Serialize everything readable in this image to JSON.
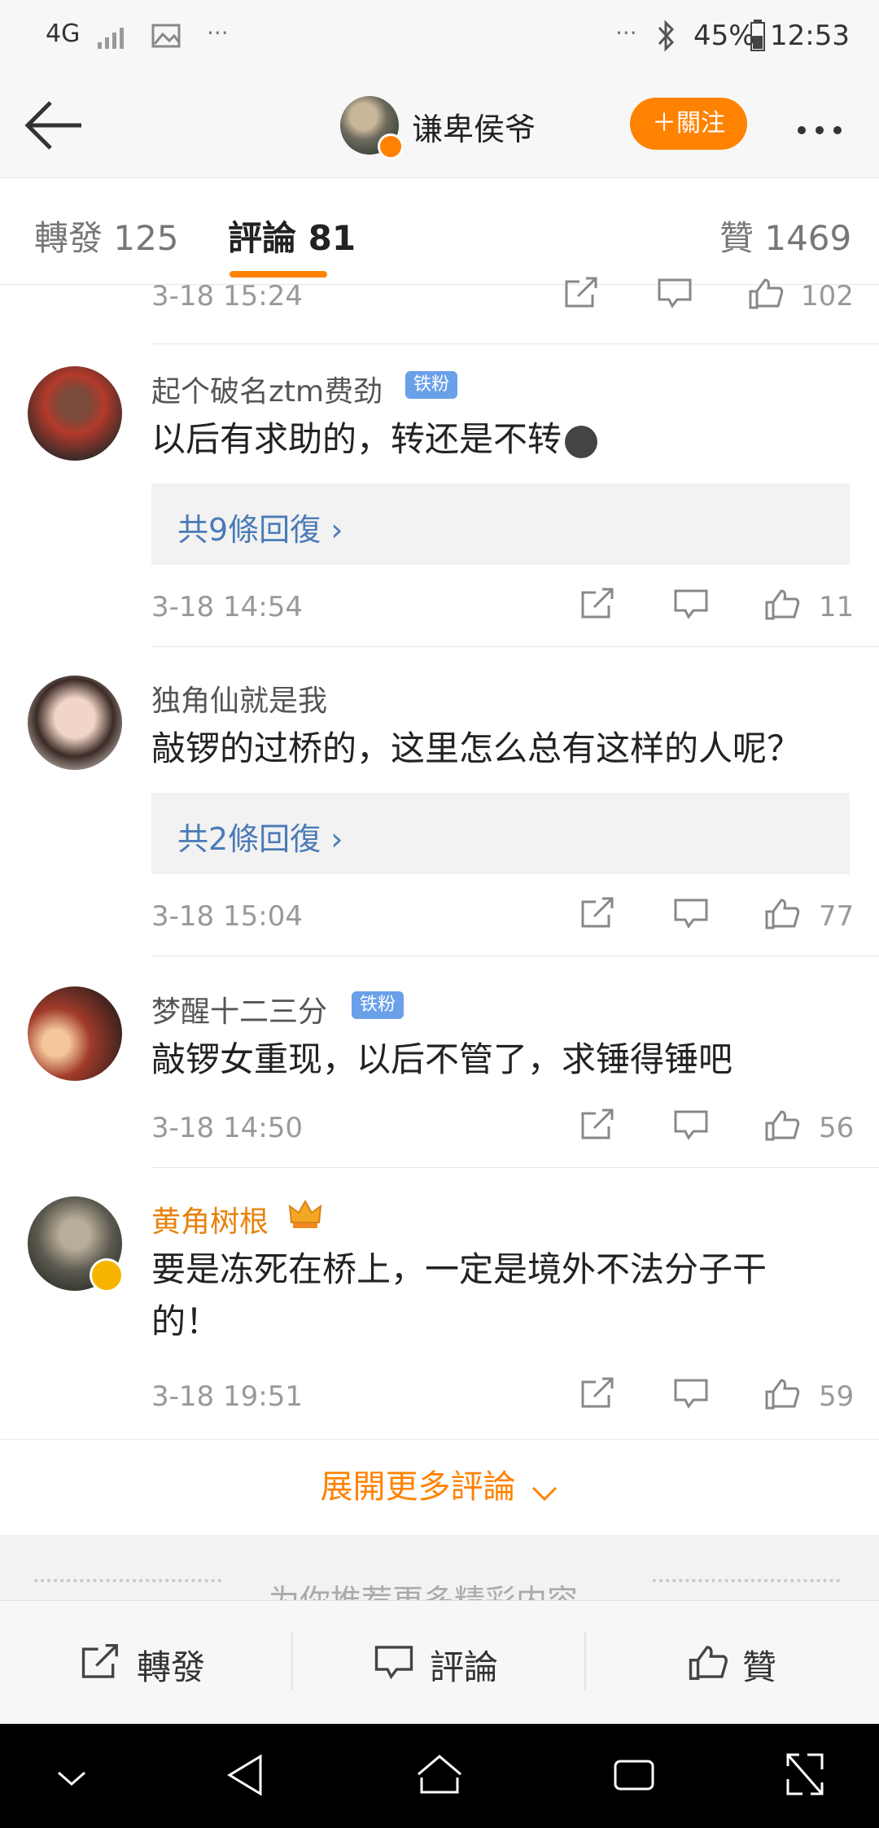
{
  "status_bar": {
    "network": "4G",
    "dots": "···",
    "battery": "45%",
    "time": "12:53"
  },
  "header": {
    "user_name": "谦卑侯爷",
    "follow_label": "＋關注"
  },
  "tabs": [
    {
      "label": "轉發 125"
    },
    {
      "label": "評論 81"
    },
    {
      "label": "贊 1469"
    }
  ],
  "top_partial": {
    "time": "3-18 15:24",
    "likes": "102"
  },
  "comments": [
    {
      "user": "起个破名ztm费劲",
      "badge": "铁粉",
      "text": "以后有求助的，转还是不转",
      "replies": "共9條回復 ›",
      "time": "3-18 14:54",
      "likes": "11"
    },
    {
      "user": "独角仙就是我",
      "text": "敲锣的过桥的，这里怎么总有这样的人呢？",
      "replies": "共2條回復 ›",
      "time": "3-18 15:04",
      "likes": "77"
    },
    {
      "user": "梦醒十二三分",
      "badge": "铁粉",
      "text": "敲锣女重现，以后不管了，求锤得锤吧",
      "time": "3-18 14:50",
      "likes": "56"
    },
    {
      "user": "黄角树根",
      "text": "要是冻死在桥上，一定是境外不法分子干的！",
      "time": "3-18 19:51",
      "likes": "59"
    }
  ],
  "expand_label": "展開更多評論",
  "recommend_text": "为你推荐更多精彩内容",
  "bottom_bar": {
    "repost": "轉發",
    "comment": "評論",
    "like": "贊"
  },
  "colors": {
    "accent": "#ff8200",
    "link": "#4a7bb7",
    "vip_name": "#e8810b"
  }
}
